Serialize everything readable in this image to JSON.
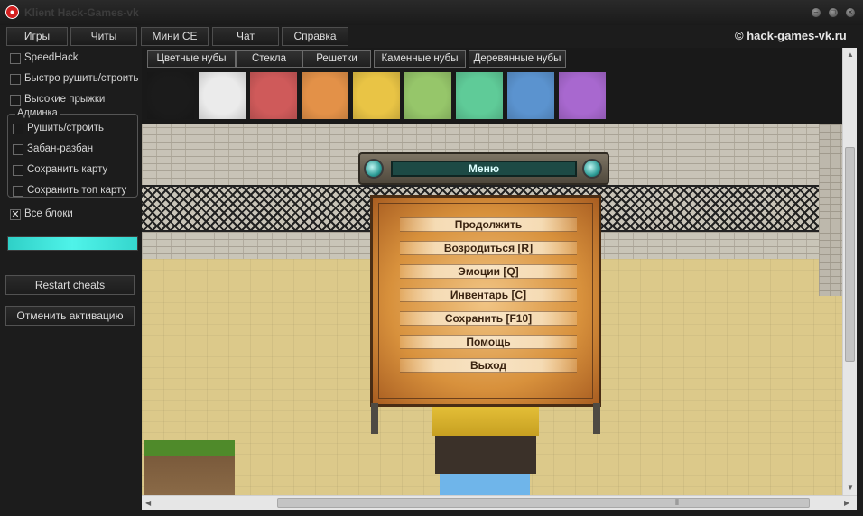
{
  "window": {
    "title": "Klient Hack-Games-vk"
  },
  "menubar": {
    "items": [
      "Игры",
      "Читы",
      "Мини CE",
      "Чат",
      "Справка"
    ],
    "site_link": "© hack-games-vk.ru"
  },
  "sidebar": {
    "checkboxes": [
      {
        "label": "SpeedHack",
        "checked": false
      },
      {
        "label": "Быстро рушить/строить",
        "checked": false
      },
      {
        "label": "Высокие прыжки",
        "checked": false
      }
    ],
    "admin_group": {
      "legend": "Админка",
      "checkboxes": [
        {
          "label": "Рушить/строить",
          "checked": false
        },
        {
          "label": "Забан-разбан",
          "checked": false
        },
        {
          "label": "Сохранить карту",
          "checked": false
        },
        {
          "label": "Сохранить топ карту",
          "checked": false
        }
      ]
    },
    "all_blocks": {
      "label": "Все блоки",
      "checked": true,
      "mark": "✕"
    },
    "progress": 1.0,
    "restart_label": "Restart cheats",
    "cancel_label": "Отменить активацию"
  },
  "block_tabs": [
    "Цветные нубы",
    "Стекла",
    "Решетки",
    "Каменные нубы",
    "Деревянные нубы"
  ],
  "swatches": [
    "#1b1b1b",
    "#ebebeb",
    "#cf5a5a",
    "#e39148",
    "#e9c445",
    "#96c66a",
    "#5fcb98",
    "#5b93cf",
    "#a868cf"
  ],
  "game_menu": {
    "title": "Меню",
    "items": [
      "Продолжить",
      "Возродиться [R]",
      "Эмоции [Q]",
      "Инвентарь [C]",
      "Сохранить [F10]",
      "Помощь",
      "Выход"
    ]
  },
  "icons": {
    "app": "app-logo-icon",
    "minimize": "minimize-icon",
    "maximize": "maximize-icon",
    "close": "close-icon",
    "scroll_grip": "⦀"
  },
  "colors": {
    "accent": "#3fe6dd",
    "background": "#1c1c1c",
    "menu_parchment": "#d8913c"
  }
}
